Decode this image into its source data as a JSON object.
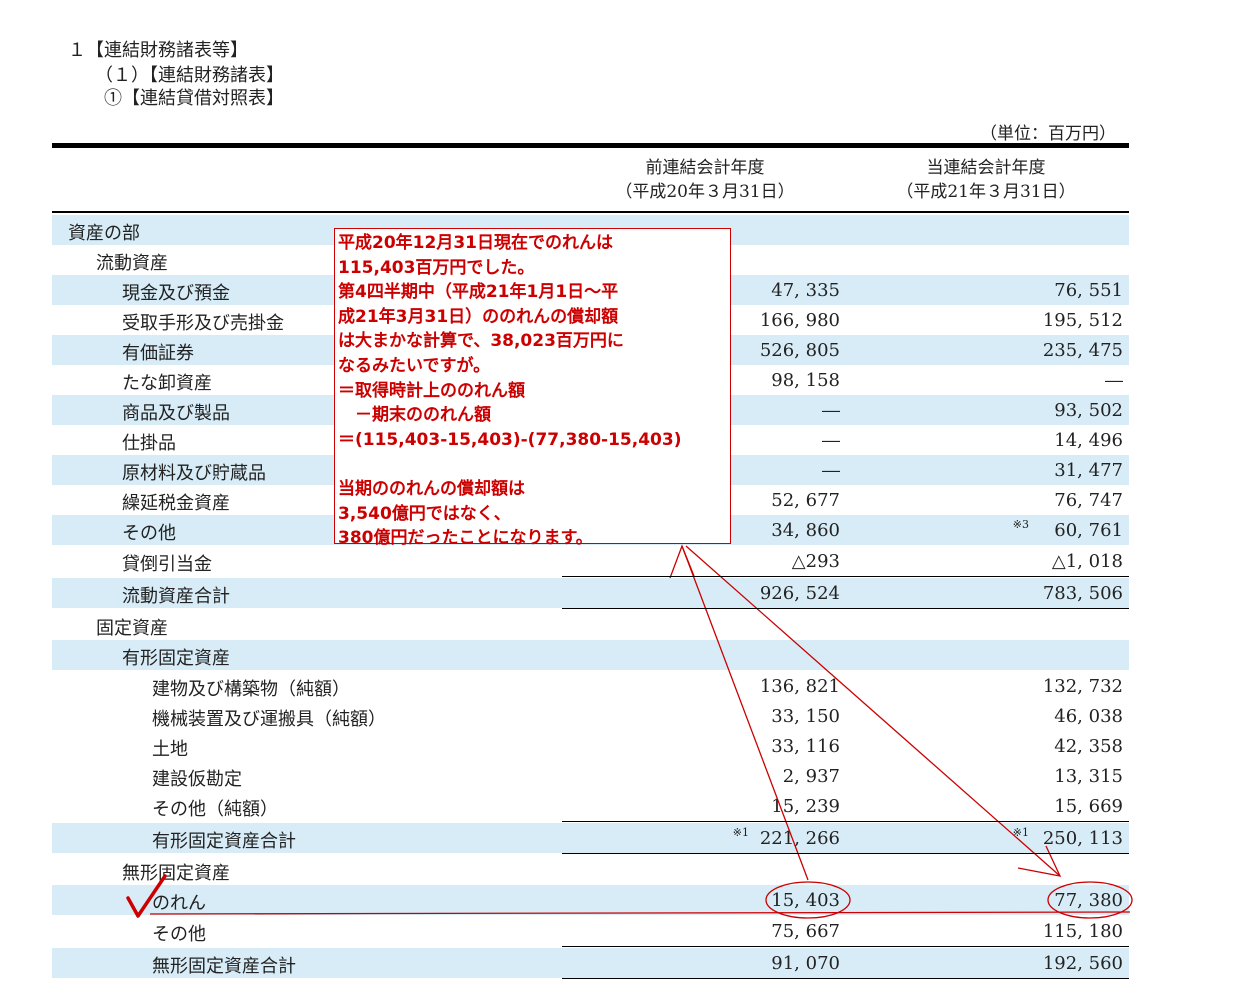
{
  "header": {
    "line1": "１【連結財務諸表等】",
    "line2": "（１）【連結財務諸表】",
    "line3": "①【連結貸借対照表】"
  },
  "unit_label": "（単位：百万円）",
  "columns": {
    "prev_title": "前連結会計年度",
    "prev_date": "（平成20年３月31日）",
    "curr_title": "当連結会計年度",
    "curr_date": "（平成21年３月31日）"
  },
  "rows": [
    {
      "label": "資産の部",
      "prev": "",
      "curr": ""
    },
    {
      "label": "流動資産",
      "prev": "",
      "curr": ""
    },
    {
      "label": "現金及び預金",
      "prev": "47, 335",
      "curr": "76, 551"
    },
    {
      "label": "受取手形及び売掛金",
      "prev": "166, 980",
      "curr": "195, 512"
    },
    {
      "label": "有価証券",
      "prev": "526, 805",
      "curr": "235, 475"
    },
    {
      "label": "たな卸資産",
      "prev": "98, 158",
      "curr": "―"
    },
    {
      "label": "商品及び製品",
      "prev": "―",
      "curr": "93, 502"
    },
    {
      "label": "仕掛品",
      "prev": "―",
      "curr": "14, 496"
    },
    {
      "label": "原材料及び貯蔵品",
      "prev": "―",
      "curr": "31, 477"
    },
    {
      "label": "繰延税金資産",
      "prev": "52, 677",
      "curr": "76, 747"
    },
    {
      "label": "その他",
      "prev": "34, 860",
      "curr": "60, 761",
      "curr_note": "※3"
    },
    {
      "label": "貸倒引当金",
      "prev": "△293",
      "curr": "△1, 018"
    },
    {
      "label": "流動資産合計",
      "prev": "926, 524",
      "curr": "783, 506"
    },
    {
      "label": "固定資産",
      "prev": "",
      "curr": ""
    },
    {
      "label": "有形固定資産",
      "prev": "",
      "curr": ""
    },
    {
      "label": "建物及び構築物（純額）",
      "prev": "136, 821",
      "curr": "132, 732"
    },
    {
      "label": "機械装置及び運搬具（純額）",
      "prev": "33, 150",
      "curr": "46, 038"
    },
    {
      "label": "土地",
      "prev": "33, 116",
      "curr": "42, 358"
    },
    {
      "label": "建設仮勘定",
      "prev": "2, 937",
      "curr": "13, 315"
    },
    {
      "label": "その他（純額）",
      "prev": "15, 239",
      "curr": "15, 669"
    },
    {
      "label": "有形固定資産合計",
      "prev": "221, 266",
      "curr": "250, 113",
      "prev_note": "※1",
      "curr_note": "※1"
    },
    {
      "label": "無形固定資産",
      "prev": "",
      "curr": ""
    },
    {
      "label": "のれん",
      "prev": "15, 403",
      "curr": "77, 380"
    },
    {
      "label": "その他",
      "prev": "75, 667",
      "curr": "115, 180"
    },
    {
      "label": "無形固定資産合計",
      "prev": "91, 070",
      "curr": "192, 560"
    }
  ],
  "annotation": {
    "lines": [
      "平成20年12月31日現在でのれんは",
      "115,403百万円でした。",
      "第4四半期中（平成21年1月1日～平",
      "成21年3月31日）ののれんの償却額",
      "は大まかな計算で、38,023百万円に",
      "なるみたいですが。",
      "＝取得時計上ののれん額",
      "　－期末ののれん額",
      "＝(115,403-15,403)-(77,380-15,403)",
      "",
      "当期ののれんの償却額は",
      "3,540億円ではなく、",
      "380億円だったことになります。"
    ],
    "color": "#cc0000"
  },
  "colors": {
    "row_shade": "#d7ecf7",
    "annotation": "#cc0000"
  }
}
